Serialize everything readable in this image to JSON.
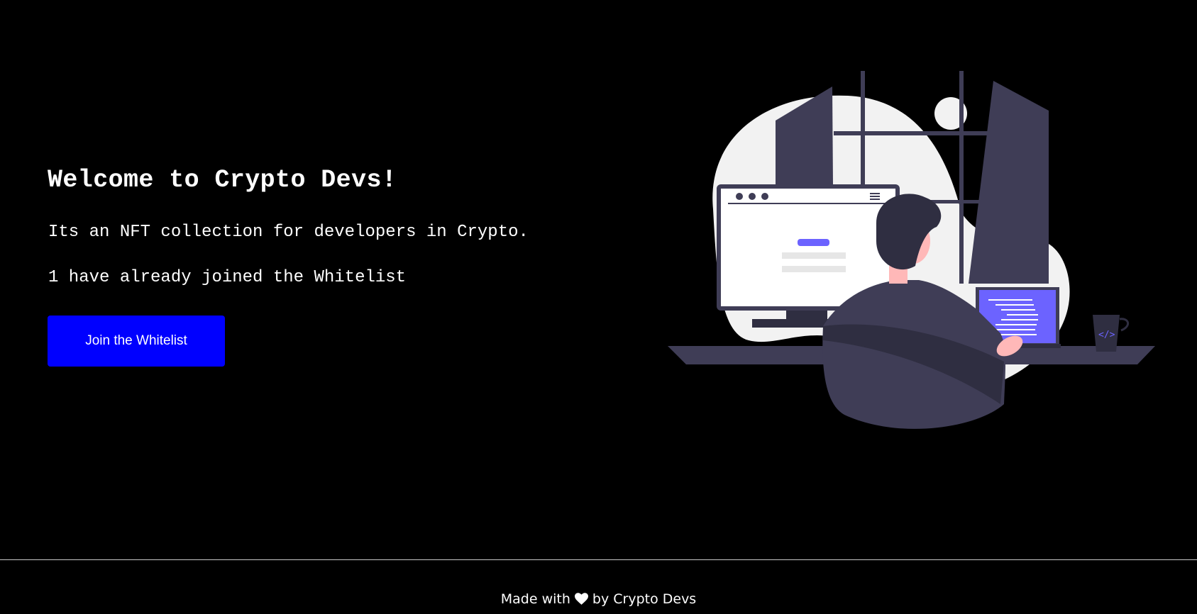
{
  "hero": {
    "title": "Welcome to Crypto Devs!",
    "description": "Its an NFT collection for developers in Crypto.",
    "whitelist_status": "1 have already joined the Whitelist",
    "button_label": "Join the Whitelist"
  },
  "illustration": {
    "icon": "developer-at-desk-illustration"
  },
  "footer": {
    "made_with": "Made with",
    "heart_icon": "heart-icon",
    "by": "by Crypto Devs"
  },
  "colors": {
    "background": "#000000",
    "text": "#ffffff",
    "button": "#0000ff",
    "accent": "#6c63ff",
    "illustration_dark": "#3f3d56"
  }
}
